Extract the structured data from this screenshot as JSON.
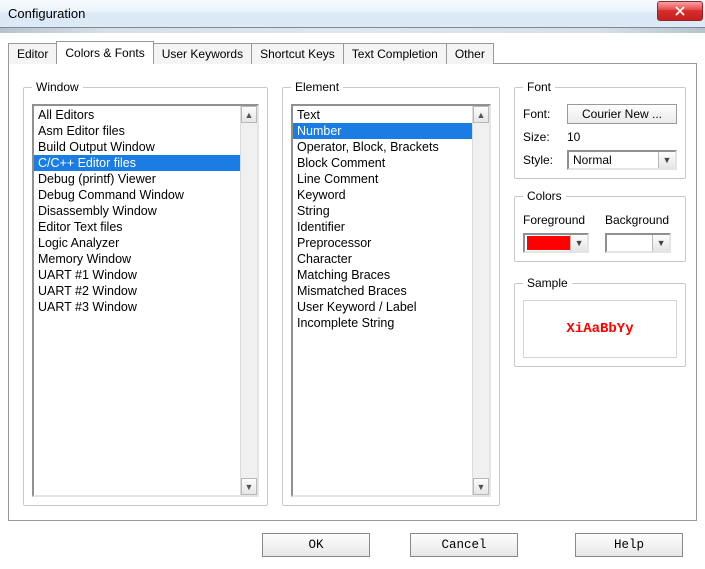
{
  "window": {
    "title": "Configuration"
  },
  "tabs": [
    {
      "label": "Editor"
    },
    {
      "label": "Colors & Fonts",
      "active": true
    },
    {
      "label": "User Keywords"
    },
    {
      "label": "Shortcut Keys"
    },
    {
      "label": "Text Completion"
    },
    {
      "label": "Other"
    }
  ],
  "group_window": {
    "legend": "Window",
    "items": [
      "All Editors",
      "Asm Editor files",
      "Build Output Window",
      "C/C++ Editor files",
      "Debug (printf) Viewer",
      "Debug Command Window",
      "Disassembly Window",
      "Editor Text files",
      "Logic Analyzer",
      "Memory Window",
      "UART #1 Window",
      "UART #2 Window",
      "UART #3 Window"
    ],
    "selected_index": 3
  },
  "group_element": {
    "legend": "Element",
    "items": [
      "Text",
      "Number",
      "Operator, Block, Brackets",
      "Block Comment",
      "Line Comment",
      "Keyword",
      "String",
      "Identifier",
      "Preprocessor",
      "Character",
      "Matching Braces",
      "Mismatched Braces",
      "User Keyword / Label",
      "Incomplete String"
    ],
    "selected_index": 1
  },
  "group_font": {
    "legend": "Font",
    "font_label": "Font:",
    "font_value": "Courier New ...",
    "size_label": "Size:",
    "size_value": "10",
    "style_label": "Style:",
    "style_value": "Normal"
  },
  "group_colors": {
    "legend": "Colors",
    "foreground_label": "Foreground",
    "background_label": "Background",
    "foreground_color": "#ff0000",
    "background_color": "#ffffff"
  },
  "group_sample": {
    "legend": "Sample",
    "text": "XiAaBbYy",
    "color": "#ff0000"
  },
  "buttons": {
    "ok": "OK",
    "cancel": "Cancel",
    "help": "Help"
  }
}
